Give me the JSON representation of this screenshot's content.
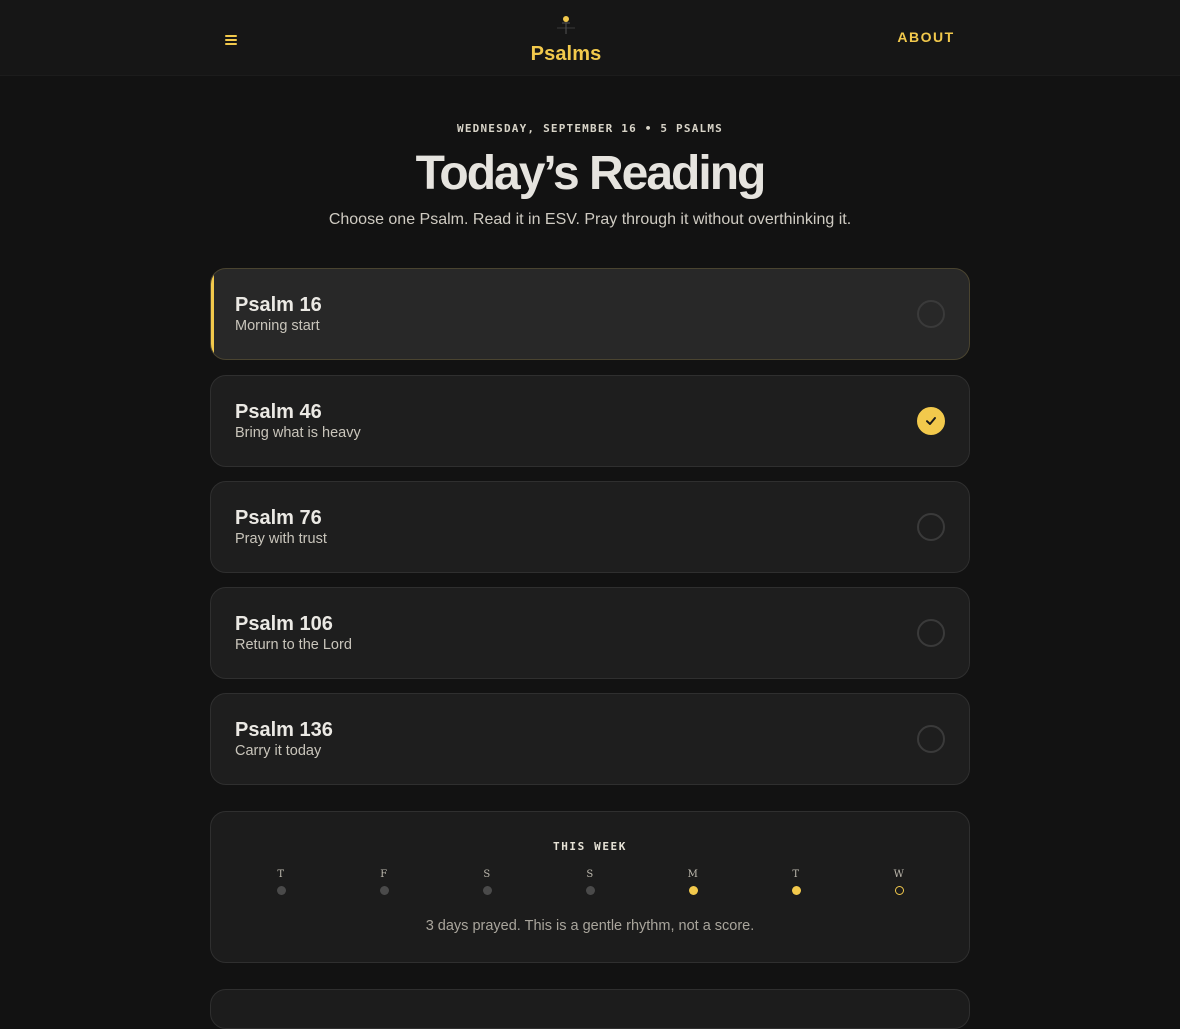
{
  "header": {
    "brand_title": "Psalms",
    "about_label": "ABOUT",
    "menu_icon": "hamburger-menu-icon",
    "brand_icon": "cross-sunrise-icon",
    "accent_color": "#f2c94c"
  },
  "intro": {
    "dateline": "WEDNESDAY, SEPTEMBER 16 • 5 PSALMS",
    "title": "Today’s Reading",
    "subtitle": "Choose one Psalm. Read it in ESV. Pray through it without overthinking it."
  },
  "psalms": [
    {
      "name": "Psalm 16",
      "note": "Morning start",
      "completed": false,
      "selected": true
    },
    {
      "name": "Psalm 46",
      "note": "Bring what is heavy",
      "completed": true,
      "selected": false
    },
    {
      "name": "Psalm 76",
      "note": "Pray with trust",
      "completed": false,
      "selected": false
    },
    {
      "name": "Psalm 106",
      "note": "Return to the Lord",
      "completed": false,
      "selected": false
    },
    {
      "name": "Psalm 136",
      "note": "Carry it today",
      "completed": false,
      "selected": false
    }
  ],
  "week": {
    "title": "THIS WEEK",
    "days": [
      {
        "letter": "T",
        "status": "missed"
      },
      {
        "letter": "F",
        "status": "missed"
      },
      {
        "letter": "S",
        "status": "missed"
      },
      {
        "letter": "S",
        "status": "missed"
      },
      {
        "letter": "M",
        "status": "done"
      },
      {
        "letter": "T",
        "status": "done"
      },
      {
        "letter": "W",
        "status": "today"
      }
    ],
    "note": "3 days prayed. This is a gentle rhythm, not a score."
  }
}
